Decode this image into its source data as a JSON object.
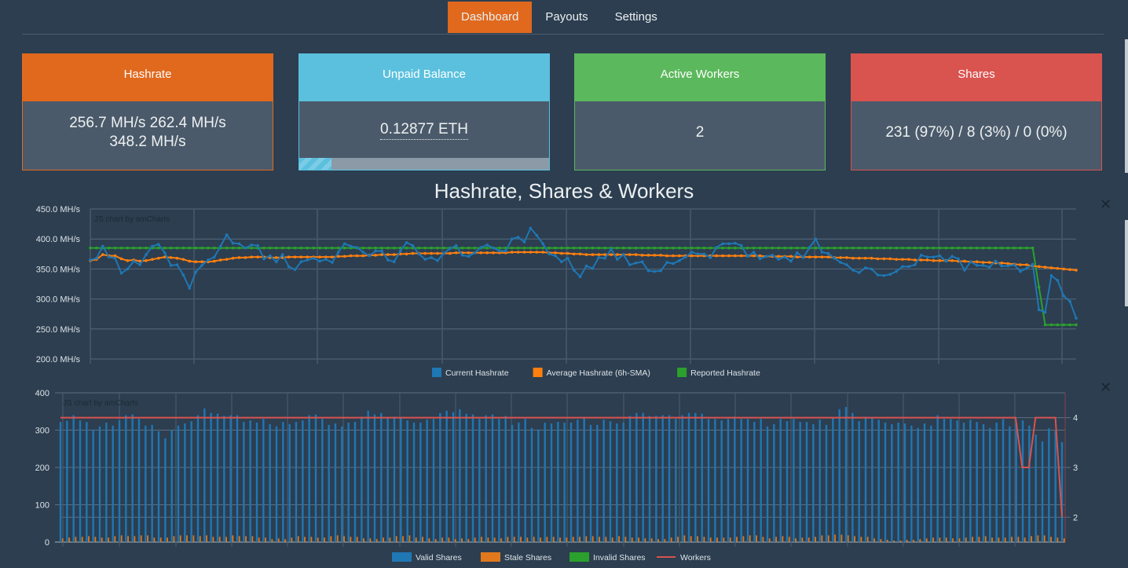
{
  "nav": {
    "items": [
      {
        "label": "Dashboard",
        "active": true
      },
      {
        "label": "Payouts",
        "active": false
      },
      {
        "label": "Settings",
        "active": false
      }
    ]
  },
  "cards": {
    "hashrate": {
      "title": "Hashrate",
      "line1": "256.7 MH/s 262.4 MH/s",
      "line2": "348.2 MH/s",
      "color": "#e0691e"
    },
    "balance": {
      "title": "Unpaid Balance",
      "value": "0.12877 ETH",
      "progress_percent": 13,
      "color": "#5bc0de"
    },
    "workers": {
      "title": "Active Workers",
      "value": "2",
      "color": "#5cb85c"
    },
    "shares": {
      "title": "Shares",
      "value": "231 (97%) / 8 (3%) / 0 (0%)",
      "color": "#d9534f"
    }
  },
  "chart_data": [
    {
      "type": "line",
      "title": "Hashrate, Shares & Workers",
      "watermark": "JS chart by amCharts",
      "ylabel": "",
      "ylim": [
        200,
        450
      ],
      "yticks": [
        "200.0 MH/s",
        "250.0 MH/s",
        "300.0 MH/s",
        "350.0 MH/s",
        "400.0 MH/s",
        "450.0 MH/s"
      ],
      "ytick_values": [
        200,
        250,
        300,
        350,
        400,
        450
      ],
      "legend_position": "bottom",
      "series": [
        {
          "name": "Current Hashrate",
          "color": "#1f77b4",
          "values": [
            365,
            368,
            388,
            370,
            368,
            343,
            350,
            363,
            357,
            374,
            388,
            391,
            377,
            356,
            357,
            340,
            318,
            345,
            356,
            365,
            370,
            388,
            407,
            393,
            392,
            385,
            390,
            389,
            367,
            372,
            362,
            374,
            354,
            349,
            362,
            365,
            368,
            363,
            366,
            361,
            378,
            392,
            388,
            386,
            378,
            372,
            380,
            380,
            365,
            362,
            380,
            394,
            389,
            375,
            366,
            369,
            364,
            376,
            384,
            389,
            373,
            371,
            377,
            386,
            390,
            385,
            380,
            380,
            400,
            403,
            395,
            418,
            406,
            392,
            375,
            372,
            362,
            368,
            348,
            337,
            355,
            351,
            369,
            368,
            383,
            366,
            374,
            357,
            360,
            362,
            347,
            346,
            347,
            361,
            359,
            364,
            370,
            378,
            375,
            375,
            369,
            386,
            392,
            392,
            393,
            389,
            371,
            378,
            367,
            371,
            373,
            366,
            370,
            363,
            377,
            369,
            386,
            400,
            378,
            376,
            368,
            361,
            357,
            348,
            344,
            352,
            350,
            340,
            339,
            341,
            346,
            354,
            354,
            357,
            373,
            370,
            370,
            372,
            363,
            371,
            367,
            348,
            362,
            356,
            356,
            353,
            363,
            355,
            355,
            357,
            346,
            351,
            358,
            282,
            278,
            339,
            331,
            305,
            296,
            268
          ]
        },
        {
          "name": "Average Hashrate (6h-SMA)",
          "color": "#ff7f0e",
          "values": [
            364,
            366,
            374,
            372,
            372,
            367,
            364,
            365,
            363,
            364,
            366,
            368,
            370,
            369,
            368,
            366,
            363,
            362,
            362,
            362,
            363,
            365,
            366,
            368,
            369,
            369,
            370,
            370,
            370,
            369,
            369,
            369,
            370,
            370,
            370,
            370,
            370,
            370,
            370,
            370,
            371,
            371,
            372,
            372,
            372,
            373,
            373,
            374,
            374,
            374,
            375,
            375,
            376,
            376,
            376,
            376,
            376,
            376,
            376,
            377,
            377,
            377,
            377,
            377,
            377,
            377,
            377,
            377,
            378,
            378,
            378,
            378,
            378,
            378,
            377,
            377,
            376,
            376,
            375,
            375,
            374,
            374,
            374,
            374,
            374,
            374,
            374,
            374,
            374,
            373,
            373,
            373,
            373,
            372,
            372,
            372,
            372,
            372,
            372,
            372,
            372,
            372,
            372,
            372,
            372,
            372,
            372,
            372,
            372,
            371,
            371,
            371,
            371,
            371,
            370,
            370,
            370,
            370,
            370,
            370,
            369,
            369,
            369,
            368,
            368,
            368,
            368,
            367,
            367,
            367,
            366,
            366,
            366,
            365,
            365,
            365,
            364,
            364,
            364,
            364,
            363,
            363,
            362,
            362,
            361,
            361,
            360,
            360,
            359,
            358,
            357,
            357,
            355,
            354,
            353,
            352,
            351,
            350,
            349,
            348
          ]
        },
        {
          "name": "Reported Hashrate",
          "color": "#2ca02c",
          "values": [
            385,
            385,
            385,
            385,
            385,
            385,
            385,
            385,
            385,
            385,
            385,
            385,
            385,
            385,
            385,
            385,
            385,
            385,
            385,
            385,
            385,
            385,
            385,
            385,
            385,
            385,
            385,
            385,
            385,
            385,
            385,
            385,
            385,
            385,
            385,
            385,
            385,
            385,
            385,
            385,
            385,
            385,
            385,
            385,
            385,
            385,
            385,
            385,
            385,
            385,
            385,
            385,
            385,
            385,
            385,
            385,
            385,
            385,
            385,
            385,
            385,
            385,
            385,
            385,
            385,
            385,
            385,
            385,
            385,
            385,
            385,
            385,
            385,
            385,
            385,
            385,
            385,
            385,
            385,
            385,
            385,
            385,
            385,
            385,
            385,
            385,
            385,
            385,
            385,
            385,
            385,
            385,
            385,
            385,
            385,
            385,
            385,
            385,
            385,
            385,
            385,
            385,
            385,
            385,
            385,
            385,
            385,
            385,
            385,
            385,
            385,
            385,
            385,
            385,
            385,
            385,
            385,
            385,
            385,
            385,
            385,
            385,
            385,
            385,
            385,
            385,
            385,
            385,
            385,
            385,
            385,
            385,
            385,
            385,
            385,
            385,
            385,
            385,
            385,
            385,
            385,
            385,
            385,
            385,
            385,
            385,
            385,
            385,
            385,
            385,
            385,
            385,
            385,
            320,
            257,
            257,
            257,
            257,
            257,
            257
          ]
        }
      ]
    },
    {
      "type": "bar",
      "watermark": "JS chart by amCharts",
      "ylim": [
        0,
        400
      ],
      "yticks": [
        "0",
        "100",
        "200",
        "300",
        "400"
      ],
      "ytick_values": [
        0,
        100,
        200,
        300,
        400
      ],
      "y2lim": [
        1.5,
        4.5
      ],
      "y2ticks": [
        "2",
        "3",
        "4"
      ],
      "y2tick_values": [
        2,
        3,
        4
      ],
      "legend_position": "bottom",
      "series": [
        {
          "name": "Valid Shares",
          "color": "#1f77b4",
          "kind": "bar",
          "values": [
            322,
            325,
            340,
            326,
            322,
            301,
            310,
            320,
            312,
            326,
            340,
            342,
            330,
            312,
            314,
            297,
            278,
            300,
            312,
            318,
            324,
            340,
            358,
            346,
            344,
            338,
            340,
            340,
            322,
            326,
            320,
            330,
            316,
            310,
            322,
            316,
            322,
            326,
            340,
            342,
            330,
            314,
            318,
            310,
            320,
            322,
            336,
            352,
            342,
            346,
            334,
            336,
            334,
            326,
            320,
            320,
            328,
            330,
            346,
            352,
            348,
            356,
            344,
            342,
            330,
            340,
            342,
            330,
            338,
            314,
            320,
            330,
            306,
            302,
            320,
            318,
            322,
            320,
            320,
            328,
            332,
            314,
            314,
            328,
            324,
            318,
            320,
            338,
            346,
            346,
            338,
            338,
            340,
            340,
            330,
            340,
            346,
            346,
            344,
            330,
            330,
            326,
            330,
            336,
            330,
            330,
            322,
            330,
            310,
            316,
            330,
            324,
            330,
            322,
            322,
            316,
            328,
            314,
            332,
            356,
            362,
            346,
            324,
            336,
            332,
            328,
            320,
            316,
            320,
            318,
            312,
            306,
            318,
            312,
            340,
            330,
            330,
            326,
            320,
            328,
            322,
            316,
            306,
            320,
            330,
            310,
            318,
            326,
            312,
            288,
            270,
            305,
            298,
            268
          ]
        },
        {
          "name": "Stale Shares",
          "color": "#e0791e",
          "kind": "bar",
          "values": [
            10,
            12,
            14,
            14,
            16,
            14,
            12,
            12,
            16,
            18,
            16,
            16,
            18,
            18,
            12,
            12,
            12,
            16,
            18,
            18,
            18,
            16,
            18,
            14,
            14,
            14,
            18,
            16,
            16,
            16,
            12,
            12,
            8,
            10,
            8,
            12,
            16,
            14,
            14,
            12,
            12,
            16,
            18,
            16,
            14,
            14,
            10,
            10,
            8,
            12,
            12,
            16,
            16,
            18,
            12,
            14,
            10,
            8,
            12,
            12,
            8,
            10,
            8,
            12,
            14,
            12,
            12,
            10,
            14,
            14,
            14,
            12,
            14,
            12,
            14,
            14,
            12,
            12,
            14,
            14,
            16,
            16,
            14,
            14,
            12,
            16,
            14,
            12,
            12,
            10,
            10,
            8,
            8,
            12,
            14,
            18,
            16,
            16,
            14,
            12,
            12,
            12,
            12,
            14,
            16,
            18,
            18,
            14,
            10,
            14,
            16,
            14,
            10,
            12,
            12,
            14,
            18,
            18,
            20,
            20,
            18,
            16,
            14,
            14,
            10,
            8,
            6,
            4,
            4,
            6,
            6,
            8,
            10,
            12,
            12,
            12,
            10,
            10,
            12,
            14,
            14,
            16,
            12,
            12,
            12,
            14,
            14,
            12,
            16,
            18,
            18,
            14,
            12,
            10
          ]
        },
        {
          "name": "Invalid Shares",
          "color": "#2ca02c",
          "kind": "bar",
          "values": []
        },
        {
          "name": "Workers",
          "color": "#d9534f",
          "kind": "line",
          "axis": "right",
          "values": [
            4,
            4,
            4,
            4,
            4,
            4,
            4,
            4,
            4,
            4,
            4,
            4,
            4,
            4,
            4,
            4,
            4,
            4,
            4,
            4,
            4,
            4,
            4,
            4,
            4,
            4,
            4,
            4,
            4,
            4,
            4,
            4,
            4,
            4,
            4,
            4,
            4,
            4,
            4,
            4,
            4,
            4,
            4,
            4,
            4,
            4,
            4,
            4,
            4,
            4,
            4,
            4,
            4,
            4,
            4,
            4,
            4,
            4,
            4,
            4,
            4,
            4,
            4,
            4,
            4,
            4,
            4,
            4,
            4,
            4,
            4,
            4,
            4,
            4,
            4,
            4,
            4,
            4,
            4,
            4,
            4,
            4,
            4,
            4,
            4,
            4,
            4,
            4,
            4,
            4,
            4,
            4,
            4,
            4,
            4,
            4,
            4,
            4,
            4,
            4,
            4,
            4,
            4,
            4,
            4,
            4,
            4,
            4,
            4,
            4,
            4,
            4,
            4,
            4,
            4,
            4,
            4,
            4,
            4,
            4,
            4,
            4,
            4,
            4,
            4,
            4,
            4,
            4,
            4,
            4,
            4,
            4,
            4,
            4,
            4,
            4,
            4,
            4,
            4,
            4,
            4,
            4,
            4,
            4,
            4,
            3,
            3,
            4,
            4,
            4,
            4,
            2
          ]
        }
      ]
    }
  ]
}
